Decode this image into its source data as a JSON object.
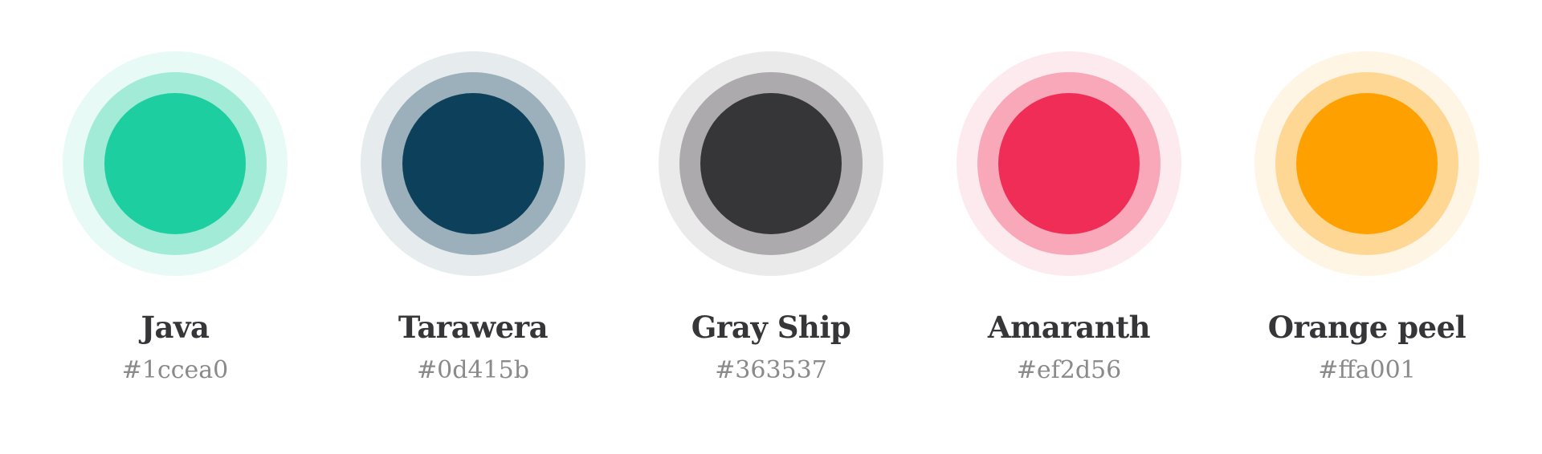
{
  "colors": [
    {
      "name": "Java",
      "hex": "#1ccea0"
    },
    {
      "name": "Tarawera",
      "hex": "#0d415b"
    },
    {
      "name": "Gray Ship",
      "hex": "#363537"
    },
    {
      "name": "Amaranth",
      "hex": "#ef2d56"
    },
    {
      "name": "Orange peel",
      "hex": "#ffa001"
    }
  ]
}
